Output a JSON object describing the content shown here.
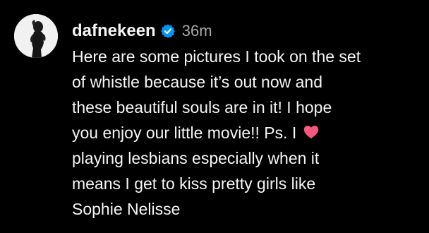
{
  "post": {
    "username": "dafnekeen",
    "verified_icon": "verified-badge-icon",
    "timestamp": "36m",
    "caption": {
      "line1": "Here are some pictures I took on the set",
      "line2": "of whistle because it’s out now and",
      "line3": "these beautiful souls are in it! I hope",
      "line4_before_icon": "you enjoy our little movie!! Ps. I ",
      "line4_icon": "pink-heart-icon",
      "line5": "playing lesbians especially when it",
      "line6": "means I get to kiss pretty girls like",
      "line7": "Sophie Nelisse"
    }
  },
  "colors": {
    "background": "#000000",
    "text": "#f5f5f5",
    "secondary_text": "#a8a8a8",
    "verified_blue": "#0095f6",
    "heart_pink": "#f7577e"
  }
}
